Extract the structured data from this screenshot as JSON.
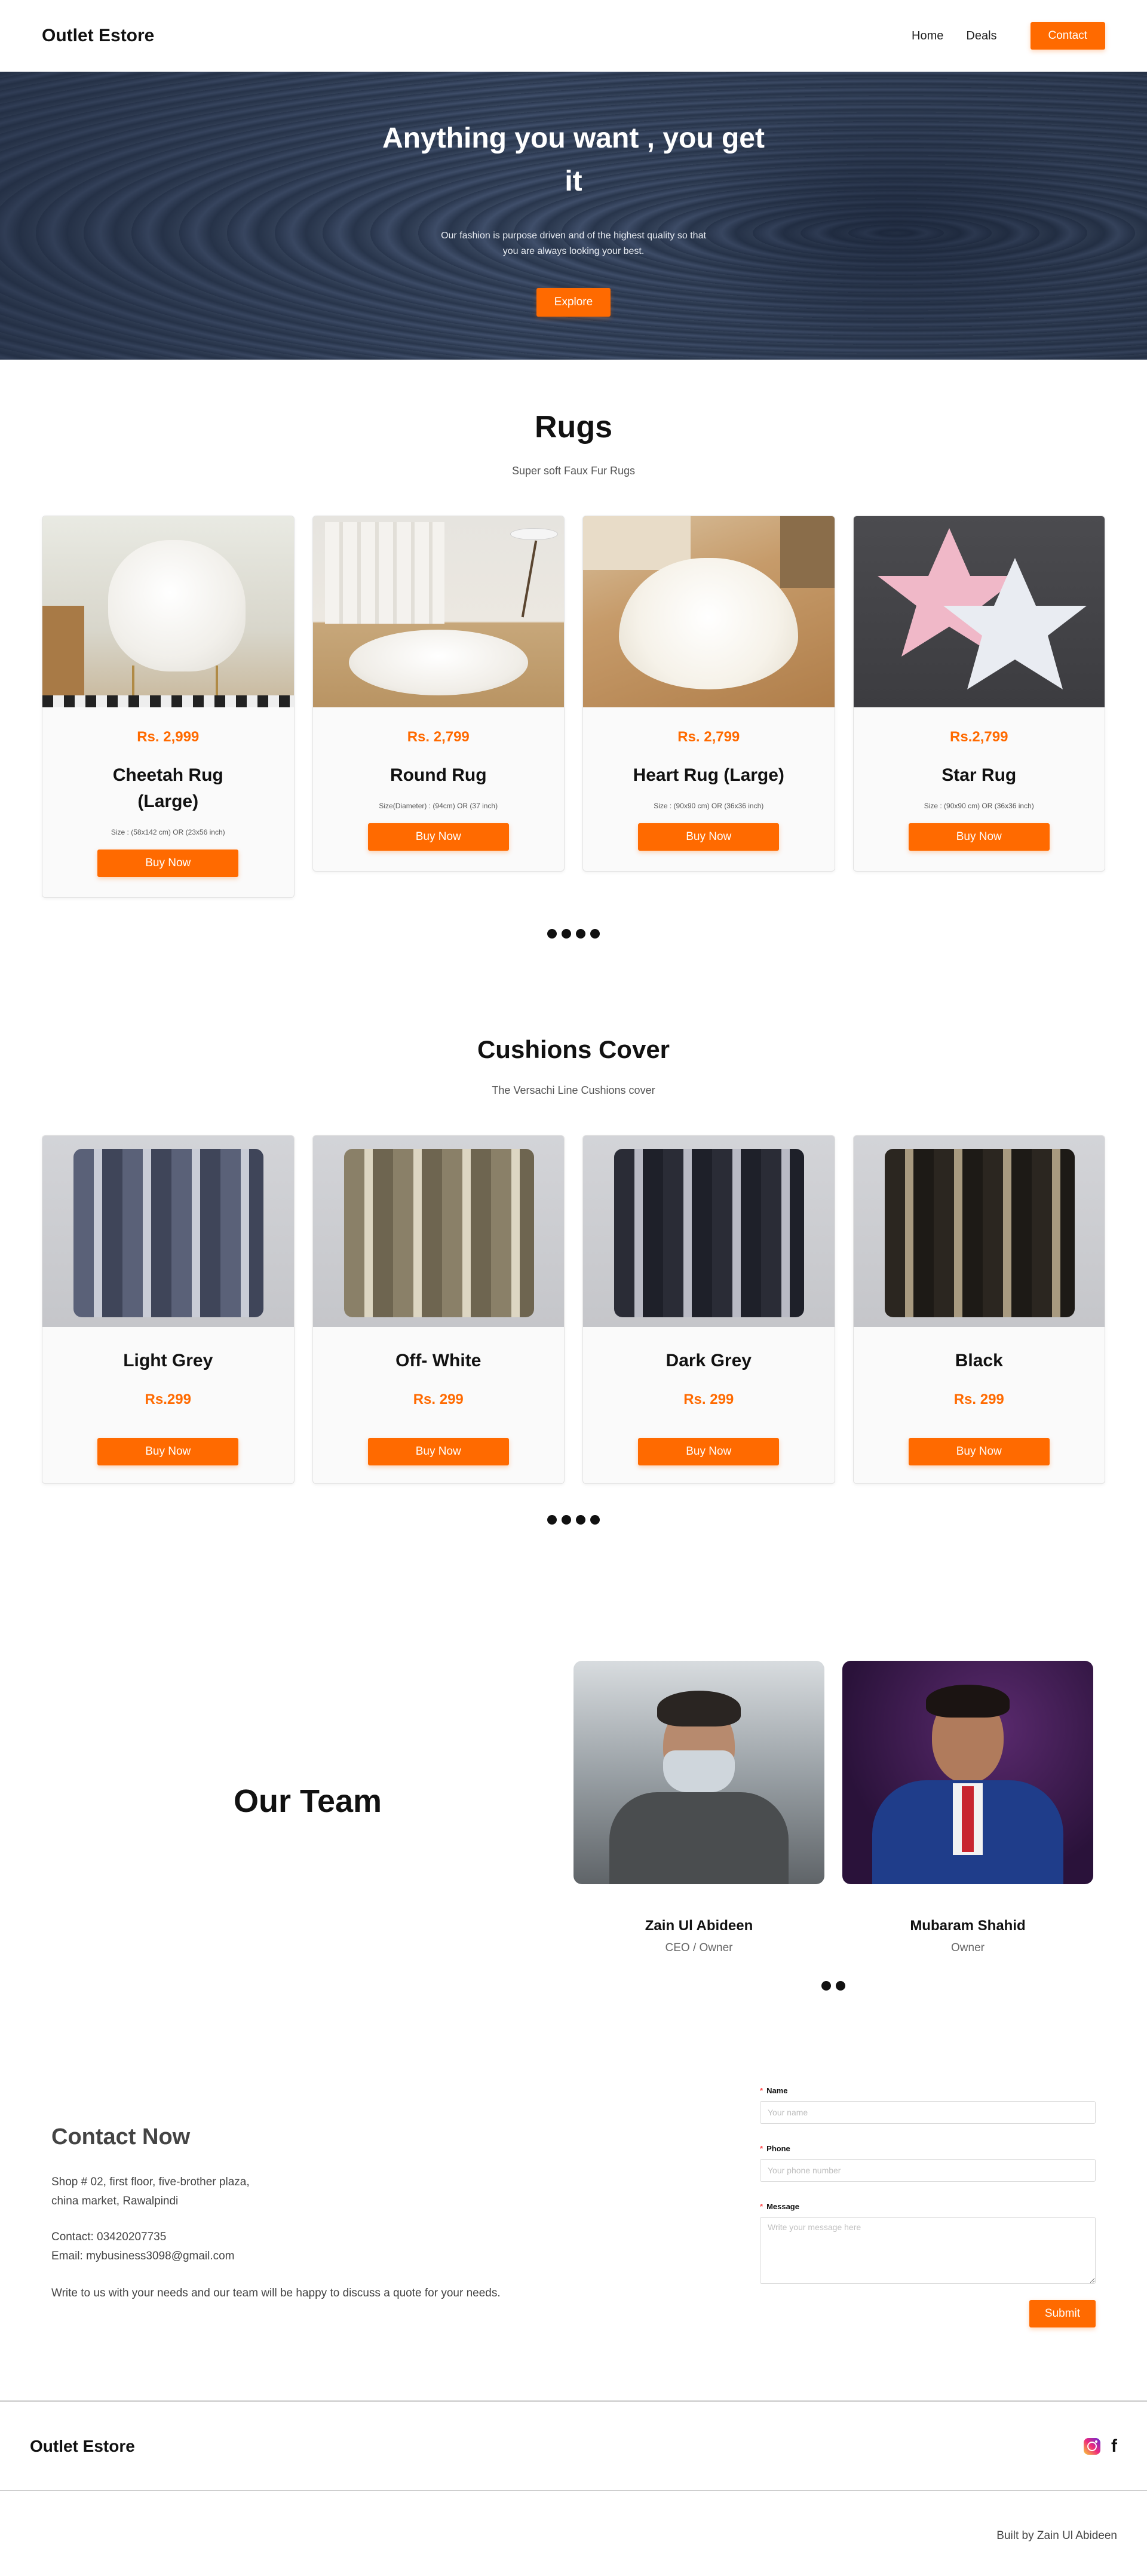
{
  "header": {
    "brand": "Outlet Estore",
    "nav": {
      "home": "Home",
      "deals": "Deals",
      "contact": "Contact"
    }
  },
  "hero": {
    "title": "Anything you want , you get it",
    "subtitle": "Our fashion is purpose driven and of the highest quality so that you are always looking your best.",
    "button": "Explore"
  },
  "rugs": {
    "title": "Rugs",
    "subtitle": "Super soft Faux Fur Rugs",
    "buy_label": "Buy Now",
    "items": [
      {
        "price": "Rs. 2,999",
        "name": "Cheetah Rug (Large)",
        "size": "Size : (58x142 cm) OR (23x56 inch)"
      },
      {
        "price": "Rs. 2,799",
        "name": "Round Rug",
        "size": "Size(Diameter) : (94cm) OR (37 inch)"
      },
      {
        "price": "Rs. 2,799",
        "name": "Heart Rug (Large)",
        "size": "Size : (90x90 cm) OR (36x36 inch)"
      },
      {
        "price": "Rs.2,799",
        "name": "Star Rug",
        "size": "Size : (90x90 cm) OR (36x36 inch)"
      }
    ]
  },
  "cushions": {
    "title": "Cushions Cover",
    "subtitle": "The Versachi Line Cushions cover",
    "buy_label": "Buy Now",
    "items": [
      {
        "name": "Light Grey",
        "price": "Rs.299"
      },
      {
        "name": "Off- White",
        "price": "Rs. 299"
      },
      {
        "name": "Dark Grey",
        "price": "Rs. 299"
      },
      {
        "name": "Black",
        "price": "Rs. 299"
      }
    ]
  },
  "team": {
    "title": "Our Team",
    "members": [
      {
        "name": "Zain Ul Abideen",
        "role": "CEO / Owner"
      },
      {
        "name": "Mubaram Shahid",
        "role": "Owner"
      }
    ]
  },
  "contact": {
    "title": "Contact Now",
    "address_line1": "Shop # 02, first floor, five-brother plaza,",
    "address_line2": "china market, Rawalpindi",
    "phone": "Contact: 03420207735",
    "email": "Email: mybusiness3098@gmail.com",
    "note": "Write to us with your needs and our team will be happy to discuss a quote for your needs.",
    "form": {
      "name_label": "Name",
      "name_placeholder": "Your name",
      "phone_label": "Phone",
      "phone_placeholder": "Your phone number",
      "message_label": "Message",
      "message_placeholder": "Write your message here",
      "submit": "Submit"
    }
  },
  "footer": {
    "brand": "Outlet Estore",
    "icons": [
      "instagram-icon",
      "facebook-icon"
    ],
    "facebook_glyph": "f",
    "credit": "Built by Zain Ul Abideen"
  },
  "colors": {
    "accent": "#ff6a00",
    "hero_bg": "#2f3d55",
    "text": "#111111"
  }
}
